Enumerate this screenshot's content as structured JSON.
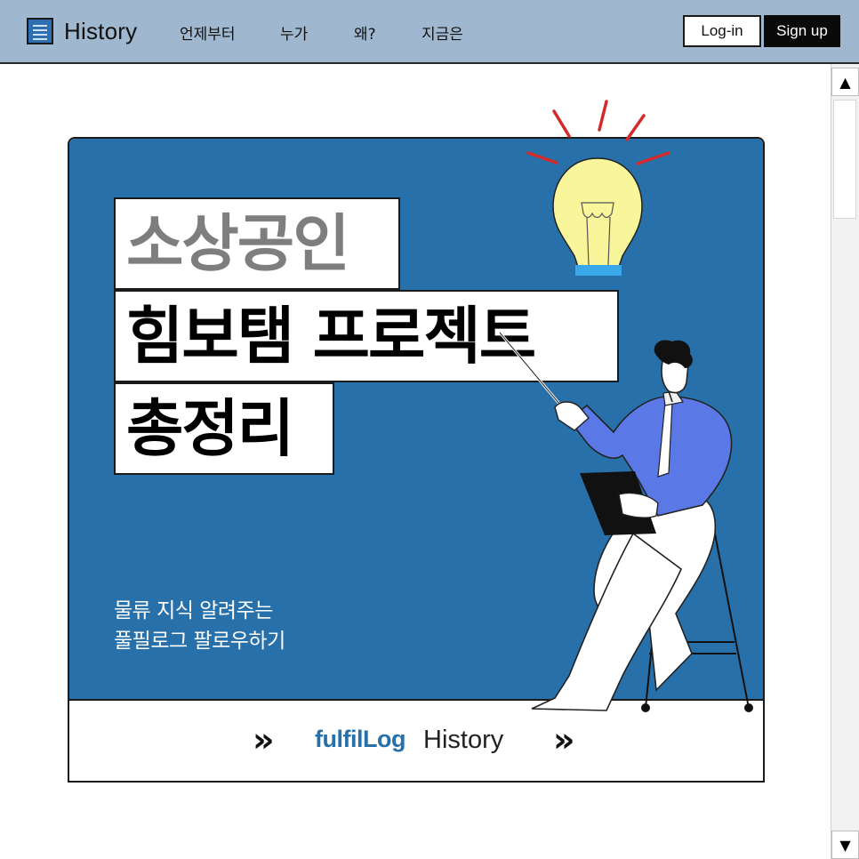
{
  "header": {
    "logo_text": "History",
    "nav": [
      "언제부터",
      "누가",
      "왜?",
      "지금은"
    ],
    "login_label": "Log-in",
    "signup_label": "Sign up"
  },
  "card": {
    "title_lines": [
      "소상공인",
      "힘보탬 프로젝트",
      "총정리"
    ],
    "subtitle_lines": [
      "물류 지식 알려주는",
      "풀필로그 팔로우하기"
    ],
    "footer": {
      "chevron_left": "»",
      "brand": "fulfilLog",
      "brand_sub": "History",
      "chevron_right": "»"
    }
  },
  "scrollbar": {
    "up": "▲",
    "down": "▼"
  },
  "colors": {
    "header_bg": "#9fb8cf",
    "card_blue": "#2870aa",
    "brand_blue": "#2870aa",
    "bulb_yellow": "#f8f59a",
    "shirt_blue": "#5a78e6",
    "ray_red": "#d42a2a"
  },
  "icons": {
    "logo": "notepad-icon",
    "scroll_up": "triangle-up-icon",
    "scroll_down": "triangle-down-icon"
  }
}
